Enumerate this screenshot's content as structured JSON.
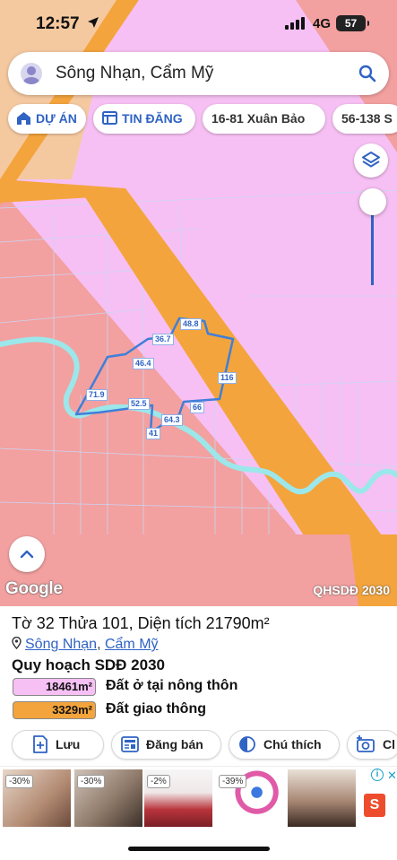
{
  "status_bar": {
    "time": "12:57",
    "network": "4G",
    "battery": "57"
  },
  "search": {
    "query": "Sông Nhạn, Cẩm Mỹ"
  },
  "chips": [
    {
      "label": "DỰ ÁN",
      "icon": "home-icon"
    },
    {
      "label": "TIN ĐĂNG",
      "icon": "listing-icon"
    },
    {
      "label": "16-81 Xuân Bảo"
    },
    {
      "label": "56-138 S"
    }
  ],
  "map": {
    "attribution": "Google",
    "plan_label": "QHSDĐ 2030",
    "segments": [
      "48.8",
      "36.7",
      "46.4",
      "116",
      "71.9",
      "52.5",
      "66",
      "64.3",
      "41"
    ],
    "colors": {
      "rural_residential": "#f7c0f4",
      "transport": "#f4a43c",
      "background": "#f3a0a0",
      "river": "#9be7ea",
      "parcel_outline": "#3f7fd8"
    }
  },
  "info": {
    "plot_title": "Tờ 32 Thửa 101, Diện tích 21790m²",
    "ward": "Sông Nhạn",
    "separator": ",",
    "district": "Cẩm Mỹ",
    "plan_title": "Quy hoạch SDĐ 2030",
    "legend": [
      {
        "value": "18461m²",
        "label": "Đất ở tại nông thôn",
        "color": "#f7c0f4"
      },
      {
        "value": "3329m²",
        "label": "Đất giao thông",
        "color": "#f4a43c"
      }
    ]
  },
  "actions": [
    {
      "label": "Lưu",
      "icon": "add-document-icon"
    },
    {
      "label": "Đăng bán",
      "icon": "newspaper-icon"
    },
    {
      "label": "Chú thích",
      "icon": "contrast-icon"
    },
    {
      "label": "Cl",
      "icon": "add-photo-icon"
    }
  ],
  "ads": {
    "badges": [
      "-30%",
      "-30%",
      "-2%",
      "-39%"
    ],
    "brand": "S"
  }
}
